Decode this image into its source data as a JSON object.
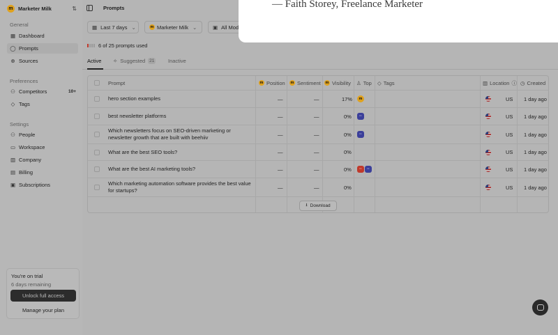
{
  "sidebar": {
    "workspace": {
      "logo": "m",
      "name": "Marketer Milk"
    },
    "sections": {
      "general": "General",
      "preferences": "Preferences",
      "settings": "Settings"
    },
    "items": {
      "dashboard": "Dashboard",
      "prompts": "Prompts",
      "sources": "Sources",
      "competitors": "Competitors",
      "competitors_count": "10+",
      "tags": "Tags",
      "people": "People",
      "workspace": "Workspace",
      "company": "Company",
      "billing": "Billing",
      "subscriptions": "Subscriptions"
    },
    "trial": {
      "title": "You're on trial",
      "subtitle": "6 days remaining",
      "unlock_label": "Unlock full access",
      "manage_label": "Manage your plan"
    }
  },
  "header": {
    "title": "Prompts"
  },
  "filters": {
    "date_range": "Last 7 days",
    "brand": "Marketer Milk",
    "models": "All Models"
  },
  "usage": {
    "text": "6 of 25 prompts used",
    "used": 6,
    "total": 25
  },
  "tabs": {
    "active": "Active",
    "suggested": "Suggested",
    "suggested_count": "21",
    "inactive": "Inactive"
  },
  "table": {
    "headers": {
      "prompt": "Prompt",
      "position": "Position",
      "sentiment": "Sentiment",
      "visibility": "Visibility",
      "top": "Top",
      "tags": "Tags",
      "location": "Location",
      "created": "Created"
    },
    "rows": [
      {
        "prompt": "hero section examples",
        "position": "—",
        "sentiment": "—",
        "visibility": "17%",
        "location": "US",
        "created": "1 day ago"
      },
      {
        "prompt": "best newsletter platforms",
        "position": "—",
        "sentiment": "—",
        "visibility": "0%",
        "location": "US",
        "created": "1 day ago"
      },
      {
        "prompt": "Which newsletters focus on SEO-driven marketing or newsletter growth that are built with beehiiv",
        "position": "—",
        "sentiment": "—",
        "visibility": "0%",
        "location": "US",
        "created": "1 day ago"
      },
      {
        "prompt": "What are the best SEO tools?",
        "position": "—",
        "sentiment": "—",
        "visibility": "0%",
        "location": "US",
        "created": "1 day ago"
      },
      {
        "prompt": "What are the best AI marketing tools?",
        "position": "—",
        "sentiment": "—",
        "visibility": "0%",
        "location": "US",
        "created": "1 day ago"
      },
      {
        "prompt": "Which marketing automation software provides the best value for startups?",
        "position": "—",
        "sentiment": "—",
        "visibility": "0%",
        "location": "US",
        "created": "1 day ago"
      }
    ],
    "download_label": "Download"
  },
  "modal": {
    "quote_attribution": "— Faith Storey, Freelance Marketer"
  },
  "colors": {
    "brand_yellow": "#e0a21d",
    "competitor_blue": "#3b3f9a",
    "competitor_red": "#c0392b",
    "overlay": "#b5b5b5"
  }
}
